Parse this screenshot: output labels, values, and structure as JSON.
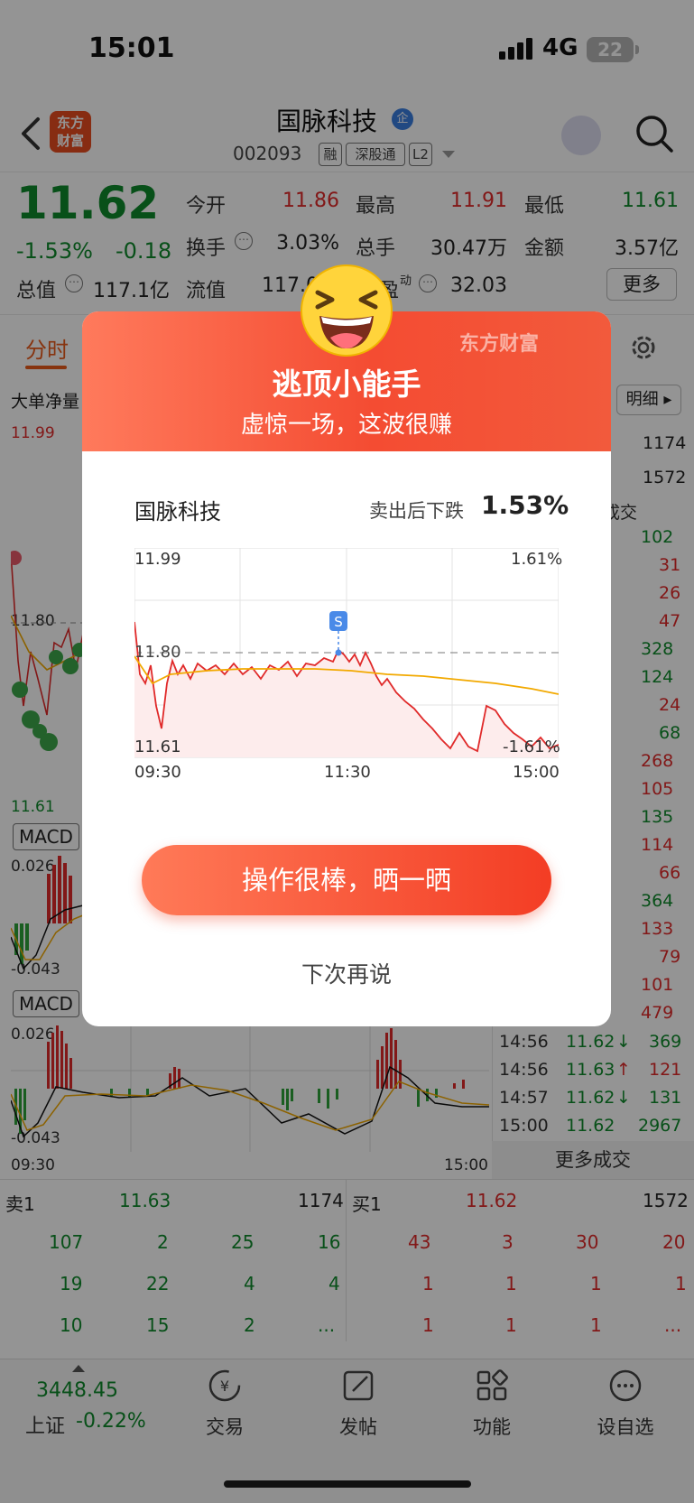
{
  "status_bar": {
    "time": "15:01",
    "network": "4G",
    "battery": "22"
  },
  "header": {
    "stock_name": "国脉科技",
    "badge": "企",
    "stock_code": "002093",
    "tags": [
      "融",
      "深股通",
      "L2"
    ],
    "logo_text": [
      "东方",
      "财富"
    ]
  },
  "quote": {
    "price": "11.62",
    "change_pct": "-1.53%",
    "change": "-0.18",
    "open_label": "今开",
    "open": "11.86",
    "high_label": "最高",
    "high": "11.91",
    "low_label": "最低",
    "low": "11.61",
    "turnover_label": "换手",
    "turnover": "3.03%",
    "volume_label": "总手",
    "volume": "30.47万",
    "amount_label": "金额",
    "amount": "3.57亿",
    "mktcap_label": "总值",
    "mktcap": "117.1亿",
    "float_label": "流值",
    "float": "117.0",
    "pe_label": "盈",
    "pe_tag": "动",
    "pe": "32.03",
    "more_label": "更多"
  },
  "tabs": {
    "fenshi": "分时",
    "detail": "明细"
  },
  "left_chart": {
    "big_order_label": "大单净量",
    "top_price": "11.99",
    "mid_price": "11.80",
    "bottom_price": "11.61",
    "macd1": "MACD",
    "macd1_top": "0.026",
    "macd1_bottom": "-0.043",
    "macd2": "MACD",
    "macd2_top": "0.026",
    "macd2_bottom": "-0.043",
    "time_start": "09:30",
    "time_end": "15:00"
  },
  "right_panel": {
    "top_val1": "1174",
    "top_val2": "1572",
    "deal_header": "成交",
    "volumes": [
      "102",
      "31",
      "26",
      "47",
      "328",
      "124",
      "24",
      "68",
      "268",
      "105",
      "135",
      "114",
      "66",
      "364",
      "133",
      "79",
      "101",
      "479"
    ],
    "trades": [
      {
        "time": "14:56",
        "price": "11.62",
        "dir": "↓",
        "vol": "369"
      },
      {
        "time": "14:56",
        "price": "11.63",
        "dir": "↑",
        "vol": "121"
      },
      {
        "time": "14:57",
        "price": "11.62",
        "dir": "↓",
        "vol": "131"
      },
      {
        "time": "15:00",
        "price": "11.62",
        "dir": "",
        "vol": "2967"
      }
    ],
    "more_trades": "更多成交"
  },
  "order_book": {
    "sell1_label": "卖1",
    "sell1_price": "11.63",
    "sell1_vol": "1174",
    "buy1_label": "买1",
    "buy1_price": "11.62",
    "buy1_vol": "1572",
    "sell_rows": [
      [
        "107",
        "2",
        "25",
        "16"
      ],
      [
        "19",
        "22",
        "4",
        "4"
      ],
      [
        "10",
        "15",
        "2",
        "..."
      ]
    ],
    "buy_rows": [
      [
        "43",
        "3",
        "30",
        "20"
      ],
      [
        "1",
        "1",
        "1",
        "1"
      ],
      [
        "1",
        "1",
        "1",
        "..."
      ]
    ]
  },
  "bottom_nav": {
    "index_value": "3448.45",
    "index_name": "上证",
    "index_change": "-0.22%",
    "items": [
      "交易",
      "发帖",
      "功能",
      "设自选"
    ]
  },
  "modal": {
    "brand": "东方财富",
    "title": "逃顶小能手",
    "subtitle": "虚惊一场，这波很赚",
    "stock_name": "国脉科技",
    "fall_label": "卖出后下跌",
    "fall_value": "1.53%",
    "chart": {
      "top_price": "11.99",
      "top_pct": "1.61%",
      "ref_price": "11.80",
      "bottom_price": "11.61",
      "bottom_pct": "-1.61%",
      "sell_marker": "S",
      "x_labels": [
        "09:30",
        "11:30",
        "15:00"
      ]
    },
    "share_button": "操作很棒，晒一晒",
    "later_button": "下次再说"
  },
  "colors": {
    "up": "#e02a2a",
    "down": "#0f8a2c",
    "accent": "#f44c32"
  }
}
